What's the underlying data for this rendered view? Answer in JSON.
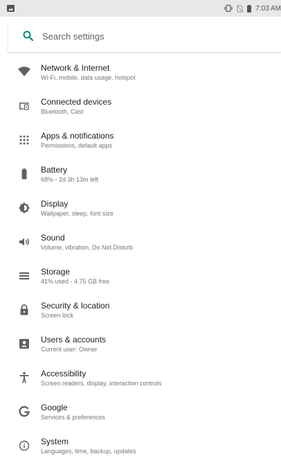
{
  "status_bar": {
    "time": "7:03 AM"
  },
  "search": {
    "placeholder": "Search settings",
    "value": ""
  },
  "colors": {
    "accent": "#00897b",
    "icon": "#616161",
    "status_bg": "#e8e8e8"
  },
  "settings": [
    {
      "title": "Network & Internet",
      "subtitle": "Wi-Fi, mobile, data usage, hotspot",
      "icon": "wifi-icon"
    },
    {
      "title": "Connected devices",
      "subtitle": "Bluetooth, Cast",
      "icon": "devices-icon"
    },
    {
      "title": "Apps & notifications",
      "subtitle": "Permissions, default apps",
      "icon": "apps-grid-icon"
    },
    {
      "title": "Battery",
      "subtitle": "68% - 2d 3h 13m left",
      "icon": "battery-icon"
    },
    {
      "title": "Display",
      "subtitle": "Wallpaper, sleep, font size",
      "icon": "brightness-icon"
    },
    {
      "title": "Sound",
      "subtitle": "Volume, vibration, Do Not Disturb",
      "icon": "volume-icon"
    },
    {
      "title": "Storage",
      "subtitle": "41% used - 4.75 GB free",
      "icon": "storage-icon"
    },
    {
      "title": "Security & location",
      "subtitle": "Screen lock",
      "icon": "lock-icon"
    },
    {
      "title": "Users & accounts",
      "subtitle": "Current user: Owner",
      "icon": "account-box-icon"
    },
    {
      "title": "Accessibility",
      "subtitle": "Screen readers, display, interaction controls",
      "icon": "accessibility-icon"
    },
    {
      "title": "Google",
      "subtitle": "Services & preferences",
      "icon": "google-icon"
    },
    {
      "title": "System",
      "subtitle": "Languages, time, backup, updates",
      "icon": "info-icon"
    }
  ]
}
